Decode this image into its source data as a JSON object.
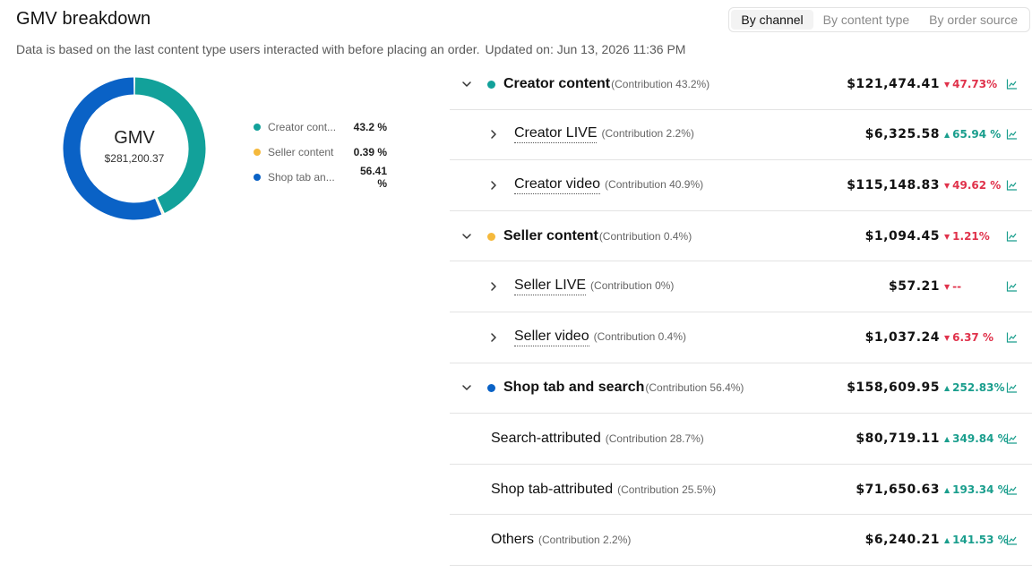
{
  "header": {
    "title": "GMV breakdown",
    "note": "Data is based on the last content type users interacted with before placing an order.",
    "updated": "Updated on: Jun 13, 2026 11:36 PM"
  },
  "tabs": [
    {
      "label": "By channel",
      "active": true
    },
    {
      "label": "By content type",
      "active": false
    },
    {
      "label": "By order source",
      "active": false
    }
  ],
  "donut": {
    "label": "GMV",
    "total": "$281,200.37",
    "segments": [
      {
        "name": "Creator content",
        "legend_name": "Creator cont...",
        "pct_label": "43.2 %",
        "share": 43.2,
        "color": "#12a19a"
      },
      {
        "name": "Seller content",
        "legend_name": "Seller content",
        "pct_label": "0.39 %",
        "share": 0.39,
        "color": "#f5b93c"
      },
      {
        "name": "Shop tab and search",
        "legend_name": "Shop tab an...",
        "pct_label": "56.41 %",
        "share": 56.41,
        "color": "#0a62c6"
      }
    ]
  },
  "colors": {
    "up": "#1a9e8d",
    "down": "#e0324b",
    "divider": "#e3e3e3"
  },
  "rows": [
    {
      "level": 1,
      "name": "Creator content",
      "contribution": "(Contribution 43.2%)",
      "value": "$121,474.41",
      "delta": "47.73%",
      "dir": "down",
      "dot": "#12a19a",
      "icon": "chevron-down-icon"
    },
    {
      "level": 2,
      "name": "Creator LIVE",
      "contribution": "(Contribution 2.2%)",
      "value": "$6,325.58",
      "delta": "65.94 %",
      "dir": "up",
      "icon": "chevron-right-icon",
      "dotted": true
    },
    {
      "level": 2,
      "name": "Creator video",
      "contribution": "(Contribution 40.9%)",
      "value": "$115,148.83",
      "delta": "49.62 %",
      "dir": "down",
      "icon": "chevron-right-icon",
      "dotted": true
    },
    {
      "level": 1,
      "name": "Seller content",
      "contribution": "(Contribution 0.4%)",
      "value": "$1,094.45",
      "delta": "1.21%",
      "dir": "down",
      "dot": "#f5b93c",
      "icon": "chevron-down-icon"
    },
    {
      "level": 2,
      "name": "Seller LIVE",
      "contribution": "(Contribution 0%)",
      "value": "$57.21",
      "delta": "--",
      "dir": "down",
      "icon": "chevron-right-icon",
      "dotted": true
    },
    {
      "level": 2,
      "name": "Seller video",
      "contribution": "(Contribution 0.4%)",
      "value": "$1,037.24",
      "delta": "6.37 %",
      "dir": "down",
      "icon": "chevron-right-icon",
      "dotted": true
    },
    {
      "level": 1,
      "name": "Shop tab and search",
      "contribution": "(Contribution 56.4%)",
      "value": "$158,609.95",
      "delta": "252.83%",
      "dir": "up",
      "dot": "#0a62c6",
      "icon": "chevron-down-icon"
    },
    {
      "level": 2,
      "name": "Search-attributed",
      "contribution": "(Contribution 28.7%)",
      "value": "$80,719.11",
      "delta": "349.84 %",
      "dir": "up",
      "nolink": true
    },
    {
      "level": 2,
      "name": "Shop tab-attributed",
      "contribution": "(Contribution 25.5%)",
      "value": "$71,650.63",
      "delta": "193.34 %",
      "dir": "up",
      "nolink": true
    },
    {
      "level": 2,
      "name": "Others",
      "contribution": "(Contribution 2.2%)",
      "value": "$6,240.21",
      "delta": "141.53 %",
      "dir": "up",
      "nolink": true
    }
  ]
}
